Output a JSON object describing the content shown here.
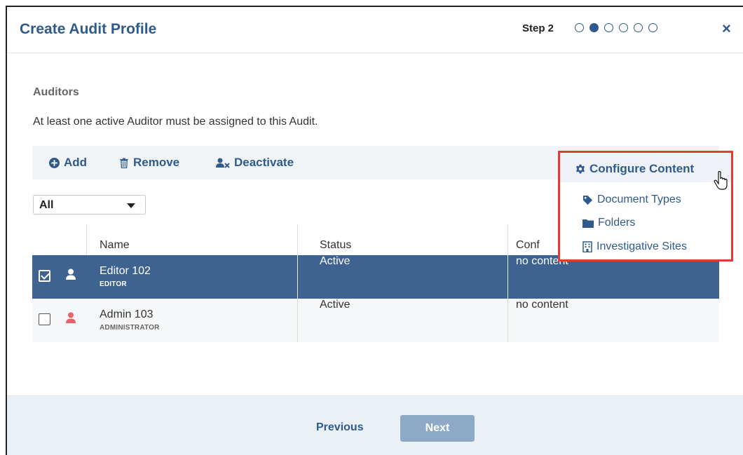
{
  "dialog": {
    "title": "Create Audit Profile",
    "step_label": "Step 2",
    "steps_total": 6,
    "current_step": 2,
    "close_icon": "×"
  },
  "section": {
    "title": "Auditors",
    "instruction": "At least one active Auditor must be assigned to this Audit."
  },
  "toolbar": {
    "add_label": "Add",
    "remove_label": "Remove",
    "deactivate_label": "Deactivate"
  },
  "filter": {
    "selected": "All"
  },
  "table": {
    "columns": [
      "Name",
      "Status",
      "Conf"
    ],
    "rows": [
      {
        "name": "Editor 102",
        "role": "EDITOR",
        "status": "Active",
        "content": "no content",
        "checked": true,
        "icon_color": "#ffffff"
      },
      {
        "name": "Admin 103",
        "role": "ADMINISTRATOR",
        "status": "Active",
        "content": "no content",
        "checked": false,
        "icon_color": "#e8626d"
      }
    ]
  },
  "configure_menu": {
    "title": "Configure Content",
    "items": [
      "Document Types",
      "Folders",
      "Investigative Sites"
    ]
  },
  "footer": {
    "previous_label": "Previous",
    "next_label": "Next"
  },
  "colors": {
    "primary": "#2f5b8c",
    "selected_row": "#3e6391",
    "highlight_border": "#e53935",
    "next_button": "#8ea9c5"
  }
}
